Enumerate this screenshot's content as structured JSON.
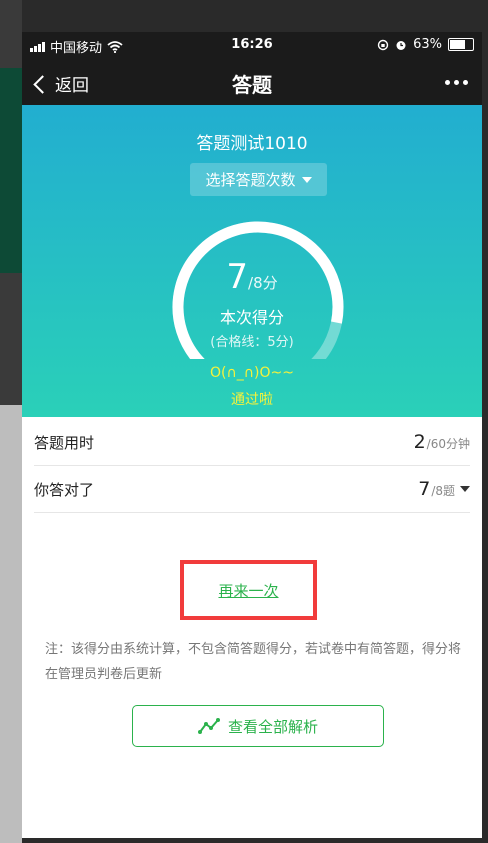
{
  "status_bar": {
    "carrier": "中国移动",
    "time": "16:26",
    "battery": "63%"
  },
  "nav": {
    "back_label": "返回",
    "title": "答题",
    "more_icon": "more-icon"
  },
  "hero": {
    "quiz_title": "答题测试1010",
    "select_label": "选择答题次数",
    "score_value": "7",
    "score_total": "/8分",
    "score_label": "本次得分",
    "pass_line": "(合格线：5分)",
    "emoticon": "O(∩_∩)O~~",
    "pass_text": "通过啦",
    "score_ratio": 0.875
  },
  "stats": [
    {
      "label": "答题用时",
      "value": "2",
      "unit": "/60分钟"
    },
    {
      "label": "你答对了",
      "value": "7",
      "unit": "/8题"
    }
  ],
  "actions": {
    "retry_label": "再来一次",
    "analysis_label": "查看全部解析",
    "analysis_icon": "trend-line-icon"
  },
  "note": "注：该得分由系统计算，不包含简答题得分，若试卷中有简答题，得分将在管理员判卷后更新",
  "colors": {
    "accent_green": "#2bb24c",
    "hero_top": "#22aed0",
    "hero_bottom": "#2ad0b8",
    "highlight_red": "#f13b3b",
    "pass_yellow": "#f7f23a"
  }
}
